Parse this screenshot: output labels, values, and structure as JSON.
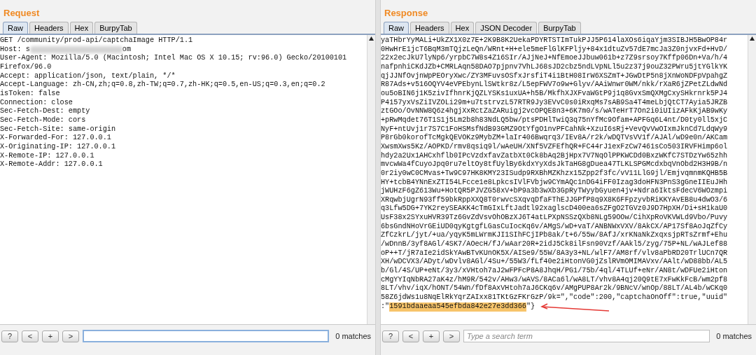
{
  "panels": [
    {
      "title": "Request",
      "tabs": [
        {
          "label": "Raw",
          "selected": true
        },
        {
          "label": "Headers",
          "selected": false
        },
        {
          "label": "Hex",
          "selected": false
        },
        {
          "label": "BurpyTab",
          "selected": false
        }
      ],
      "lines": [
        {
          "kind": "plain",
          "text": "GET /community/prod-api/captchaImage HTTP/1.1"
        },
        {
          "kind": "redacted",
          "before": "Host: s",
          "after": "om"
        },
        {
          "kind": "plain",
          "text": "User-Agent: Mozilla/5.0 (Macintosh; Intel Mac OS X 10.15; rv:96.0) Gecko/20100101"
        },
        {
          "kind": "plain",
          "text": "Firefox/96.0"
        },
        {
          "kind": "plain",
          "text": "Accept: application/json, text/plain, */*"
        },
        {
          "kind": "plain",
          "text": "Accept-Language: zh-CN,zh;q=0.8,zh-TW;q=0.7,zh-HK;q=0.5,en-US;q=0.3,en;q=0.2"
        },
        {
          "kind": "plain",
          "text": "isToken: false"
        },
        {
          "kind": "plain",
          "text": "Connection: close"
        },
        {
          "kind": "plain",
          "text": "Sec-Fetch-Dest: empty"
        },
        {
          "kind": "plain",
          "text": "Sec-Fetch-Mode: cors"
        },
        {
          "kind": "plain",
          "text": "Sec-Fetch-Site: same-origin"
        },
        {
          "kind": "plain",
          "text": "X-Forwarded-For: 127.0.0.1"
        },
        {
          "kind": "plain",
          "text": "X-Originating-IP: 127.0.0.1"
        },
        {
          "kind": "plain",
          "text": "X-Remote-IP: 127.0.0.1"
        },
        {
          "kind": "plain",
          "text": "X-Remote-Addr: 127.0.0.1"
        }
      ],
      "search": {
        "buttons": [
          "?",
          "<",
          "+",
          ">"
        ],
        "focused": true,
        "matches": "0 matches"
      }
    },
    {
      "title": "Response",
      "tabs": [
        {
          "label": "Raw",
          "selected": true
        },
        {
          "label": "Headers",
          "selected": false
        },
        {
          "label": "Hex",
          "selected": false
        },
        {
          "label": "JSON Decoder",
          "selected": false
        },
        {
          "label": "BurpyTab",
          "selected": false
        }
      ],
      "lines": [
        {
          "kind": "plain",
          "text": "yaTHbrYyMALi+UkZX1X0z7E+2K9B8K2UekaPDYRTSTImTukPJJ5P614laXOs6iqaYjm3SIBJH5BwOP84r"
        },
        {
          "kind": "plain",
          "text": "0HwHrE1jcT6BqM3mTQjzLeQn/WRnt+H+ele5meFlGlKFPljy+84x1dtuZv57dE7mcJa3Z0njvxFd+HvD/"
        },
        {
          "kind": "plain",
          "text": "22x2ecJkU7lyNp6/yrpbC7W8s4Z16SIr/AJjNeJ+NfEmoeJJbuw061b+z7Z9srsoy7Kffp06Dn+Va/h/4"
        },
        {
          "kind": "plain",
          "text": "nafpnhiCKdJZb+CMRLAqn58DAO7pjpnv7VhLJ68sJD2cbz5ndLVpNLl5u2z37j9ouZ32PWru5jtYGlkYK"
        },
        {
          "kind": "plain",
          "text": "qjJJNfOvjnWpPEOryXwc/ZY3MFuvsOSfxJrsfiT4i1BtH08IrW6XSZmT+JGwDtP5n8jXnWoNDFpVpahgZ"
        },
        {
          "kind": "plain",
          "text": "R87Ads+v516OQYV4eVPEbynLlSWtkr8z/L5epFWV7o9w+Glyv/AAiWnwr0WM/nkk/rXaR6jZPetZLdwNd"
        },
        {
          "kind": "plain",
          "text": "ou5oBIN6j1K5zivIfhnrKjQZLYSKs1uxUA+h5B/MkfhXJXFvaWGtP9j1q8GvxSmQXMgCxySHkrnrk5PJ4"
        },
        {
          "kind": "plain",
          "text": "P4157yxVsZiIVZOLi29m+u7tstrvzL57RTR9Jy3EVvC0s0iRxqMs7sAB9Sa4T4meLbjQtCT7Ayia5JRZB"
        },
        {
          "kind": "plain",
          "text": "ztGOo/OvNNW8Q6z4hgjXxRctZaZARuigj2vcOPQE8n3+6K7m0/s/wATeHrT7On2i0iUIizAFkKjAB9wKy"
        },
        {
          "kind": "plain",
          "text": "+pRwMqdet76T1S1j5Lm2b8h83NdLQ5bw/ptsPDHlTwiQ3q75nYfMc9Ofam+APFGq6L4nt/D0ty0ll5xjC"
        },
        {
          "kind": "plain",
          "text": "NyF+ntUvj1r7S7C1FoHSMsfNdB93GMZ9OtYfgO1nvPFCahNk+XzuI6sRj+VevQvVwOIxmJknCd7LdqWy9"
        },
        {
          "kind": "plain",
          "text": "P8rGb0korofTcMgkQEVOKz9MybZM+laIr406Bwqrq3/IEv8A/r2k/wDQTVsVV1f/AJAl/wD9e0n/AKCam"
        },
        {
          "kind": "plain",
          "text": "XwsmXws5Kz/AOPKD/rmv8qsiq9l/wAeUH/XNf5VZFEfhQR+FC44rJ1exFzCw7461sCo503IRVFHimp6ol"
        },
        {
          "kind": "plain",
          "text": "hdy2a2Ux1AHCxhflb0IPcVzdxfavZatbXt0Ck8bAq2BjHpx7V7NqOlPPKWCDd0BxzWKfC7STDzYw65zhh"
        },
        {
          "kind": "plain",
          "text": "mvcwWa4fCuyoJpq0ru7eltOy8tfUylBy6kdxYyXdsJkTaHG8gDuea47TLKLSPGMcdxbqVnObd2H3H9B/n"
        },
        {
          "kind": "plain",
          "text": "0r2iy0wC0CMvas+Tw9C97HK8KMY23ISudp9RXBhMZKhzx15Zpp2f3fc/vV11LlG9jl/EmjvqmnmKQHB5B"
        },
        {
          "kind": "plain",
          "text": "HY+tcbB4YNnExZTI54LFcce1e8LpkcsIVlFVbjw9CYmAQc1nDG4iFF0Izag3doHFN3PnS3gGneIIEuJHh"
        },
        {
          "kind": "plain",
          "text": "jWUHzF6gZ613Wu+HotQR5PJVZG58xV+bP9a3b3wXb3GpRyTWyybGyuen4jv+Ndra6IktsFdecV6WOzmpi"
        },
        {
          "kind": "plain",
          "text": "XRqwbjUgrN93ff59bkRppXXQ8T0rwvcSXqvqDfaFThEJJGPfP8q9X8K6FFpzyvbRiKKYAvEB8u4dwO3/6"
        },
        {
          "kind": "plain",
          "text": "q3Lfw5DG+7YK2reySEAKK4cTmGIxLftJadtl92xaglscD400ea6sZFgO2TGVz0J9D7HpXH/Di+sH1kaU0"
        },
        {
          "kind": "plain",
          "text": "UsF38x2SYxuHVR39Tz6GvZdVsvOhOBzXJ6T4atLPXpNSSzQXb8NLg59OOw/CihXpRoVKVWLd9Vbo/Puvy"
        },
        {
          "kind": "plain",
          "text": "6bsGndNHoVrGEiUD0qyKgtgfLGasCuIocKq6v/AMgS/wD+vaT/ANBNWxVXV/8AkCX/AP17Sf8AoJqZfCy"
        },
        {
          "kind": "plain",
          "text": "ZfCzkrL/jyt/+ua/yqyK5mLWrmKJI1SIhFCjIPb8ak/t+6/55w/8AfJ/xrKNaNkZxqxsjpRTsZrmf+Ehu"
        },
        {
          "kind": "plain",
          "text": "/wDnnB/3yf8AGl/4SK7/AOecH/fJ/wAar20R+2idJ5Ck8ilFsn90Vzf/AAkl5/zyg/75P+NL/wAJLef88"
        },
        {
          "kind": "plain",
          "text": "oP++T/jR7aIe2idSkYAwBTvKUnOK5X/AISe9/55W/8A3y3+NL/wlF7/AM8rf/vlv8aPbRD20TrlUCn7QR"
        },
        {
          "kind": "plain",
          "text": "XH/wDCVX3/ADyt/wDvlv8AGl/4Su+/55W3/fLf40e2iHtonVG0jZslRVmOMIMAVxv/AAlt/wD88bb/AL5"
        },
        {
          "kind": "plain",
          "text": "b/Gl/4S/UP+eNt/3y3/xVHtoh7aJ2wFPFcP8A8JhqH/PG1/75b/4ql/4TLUf+eNr/AN8t/wDFUe2iHton"
        },
        {
          "kind": "plain",
          "text": "cMgYYIqNbRA27aK4z/hM9R/542v/AHw3/wAVS/8ACa6l/wA8LT/vhv8A4qj20Q9tE7xFwKkFcB/wm2pf8"
        },
        {
          "kind": "plain",
          "text": "8LT/vhv/iqX/hONT/54Wn/fDf8AxVHtoh7aJ6CKq6v/AMgPUP8Ar2k/9BNcV/wnOp/88LT/AL4b/wCKq0"
        },
        {
          "kind": "plain",
          "text": "58Z6jdWs1u8NqElRkYqrZAIxx81TKtGzFKrGzP/9k=\",\"code\":200,\"captchaOnOff\":true,\"uuid\""
        },
        {
          "kind": "highlighted",
          "before": ":\"",
          "highlight": "1591bdaaeaa545efbda842e27e3dd366",
          "after": "\"}",
          "arrow": true
        }
      ],
      "search": {
        "buttons": [
          "?",
          "<",
          "+",
          ">"
        ],
        "placeholder": "Type a search term",
        "focused": false,
        "matches": "0 matches"
      }
    }
  ]
}
